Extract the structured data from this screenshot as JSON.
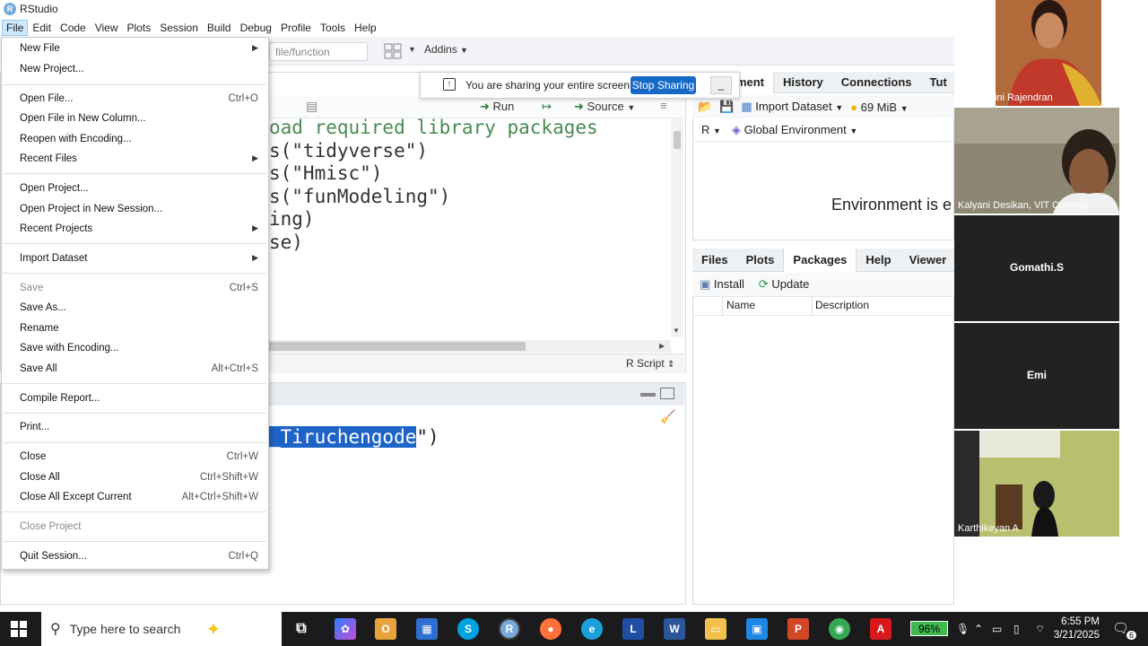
{
  "app": {
    "title": "RStudio",
    "logo_letter": "R"
  },
  "menubar": [
    "File",
    "Edit",
    "Code",
    "View",
    "Plots",
    "Session",
    "Build",
    "Debug",
    "Profile",
    "Tools",
    "Help"
  ],
  "toolbar": {
    "goto_placeholder": "file/function",
    "addins_label": "Addins"
  },
  "editor": {
    "run_label": "Run",
    "source_label": "Source",
    "code_lines": [
      {
        "text": "oad required library packages",
        "cls": "cmt"
      },
      {
        "text": "s(\"tidyverse\")",
        "cls": "str"
      },
      {
        "text": "s(\"Hmisc\")",
        "cls": "str"
      },
      {
        "text": "s(\"funModeling\")",
        "cls": "str"
      },
      {
        "text": "ing)",
        "cls": "str"
      },
      {
        "text": "se)",
        "cls": "str"
      }
    ],
    "language_label": "R Script"
  },
  "console": {
    "highlighted": "_Tiruchengode",
    "rest": "\")"
  },
  "env_pane": {
    "tabs": [
      "nment",
      "History",
      "Connections",
      "Tut"
    ],
    "import_dataset": "Import Dataset",
    "memory": "69 MiB",
    "r_label": "R",
    "scope": "Global Environment",
    "empty_message": "Environment is e"
  },
  "files_pane": {
    "tabs": [
      "Files",
      "Plots",
      "Packages",
      "Help",
      "Viewer"
    ],
    "install_label": "Install",
    "update_label": "Update",
    "columns": [
      "Name",
      "Description"
    ]
  },
  "share_banner": {
    "message": "You are sharing your entire screen.",
    "stop_label": "Stop Sharing",
    "minimize_label": "_"
  },
  "file_menu": {
    "items": [
      {
        "label": "New File",
        "shortcut": "",
        "submenu": true,
        "disabled": false
      },
      {
        "label": "New Project...",
        "shortcut": "",
        "submenu": false,
        "disabled": false
      },
      {
        "label": "Open File...",
        "shortcut": "Ctrl+O",
        "submenu": false,
        "disabled": false
      },
      {
        "label": "Open File in New Column...",
        "shortcut": "",
        "submenu": false,
        "disabled": false
      },
      {
        "label": "Reopen with Encoding...",
        "shortcut": "",
        "submenu": false,
        "disabled": false
      },
      {
        "label": "Recent Files",
        "shortcut": "",
        "submenu": true,
        "disabled": false
      },
      {
        "label": "Open Project...",
        "shortcut": "",
        "submenu": false,
        "disabled": false
      },
      {
        "label": "Open Project in New Session...",
        "shortcut": "",
        "submenu": false,
        "disabled": false
      },
      {
        "label": "Recent Projects",
        "shortcut": "",
        "submenu": true,
        "disabled": false
      },
      {
        "label": "Import Dataset",
        "shortcut": "",
        "submenu": true,
        "disabled": false
      },
      {
        "label": "Save",
        "shortcut": "Ctrl+S",
        "submenu": false,
        "disabled": true
      },
      {
        "label": "Save As...",
        "shortcut": "",
        "submenu": false,
        "disabled": false
      },
      {
        "label": "Rename",
        "shortcut": "",
        "submenu": false,
        "disabled": false
      },
      {
        "label": "Save with Encoding...",
        "shortcut": "",
        "submenu": false,
        "disabled": false
      },
      {
        "label": "Save All",
        "shortcut": "Alt+Ctrl+S",
        "submenu": false,
        "disabled": false
      },
      {
        "label": "Compile Report...",
        "shortcut": "",
        "submenu": false,
        "disabled": false
      },
      {
        "label": "Print...",
        "shortcut": "",
        "submenu": false,
        "disabled": false
      },
      {
        "label": "Close",
        "shortcut": "Ctrl+W",
        "submenu": false,
        "disabled": false
      },
      {
        "label": "Close All",
        "shortcut": "Ctrl+Shift+W",
        "submenu": false,
        "disabled": false
      },
      {
        "label": "Close All Except Current",
        "shortcut": "Alt+Ctrl+Shift+W",
        "submenu": false,
        "disabled": false
      },
      {
        "label": "Close Project",
        "shortcut": "",
        "submenu": false,
        "disabled": true
      },
      {
        "label": "Quit Session...",
        "shortcut": "Ctrl+Q",
        "submenu": false,
        "disabled": false
      }
    ]
  },
  "participants": [
    {
      "name": "Dr.S.Nalini Rajendran",
      "video": true
    },
    {
      "name": "Kalyani Desikan, VIT Chennai",
      "video": true
    },
    {
      "name": "Gomathi.S",
      "video": false
    },
    {
      "name": "Emi",
      "video": false
    },
    {
      "name": "Karthikeyan A",
      "video": true
    }
  ],
  "taskbar": {
    "search_placeholder": "Type here to search",
    "battery": "96%",
    "time": "6:55 PM",
    "date": "3/21/2025",
    "notifications": "6"
  }
}
